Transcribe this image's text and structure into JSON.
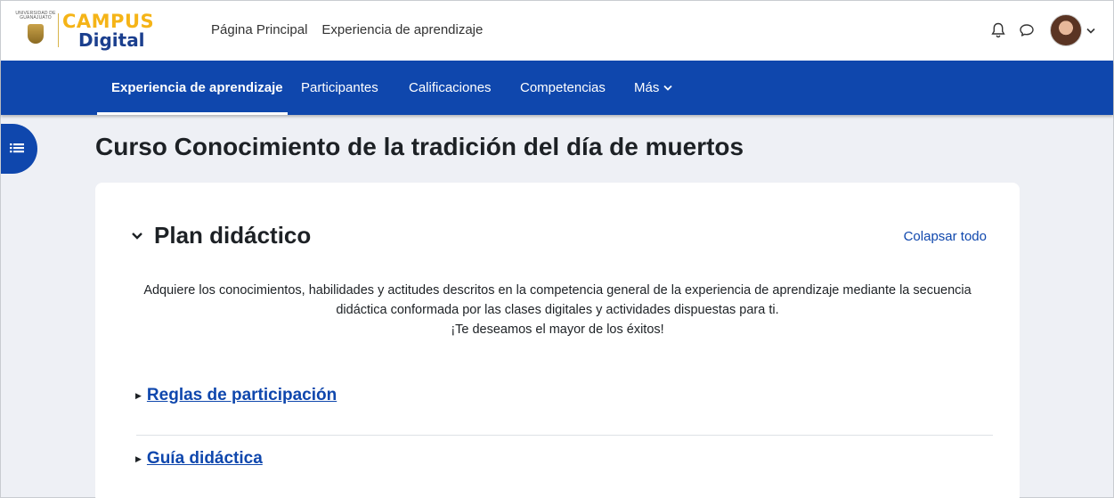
{
  "brand": {
    "university_text": "UNIVERSIDAD DE GUANAJUATO",
    "campus": "CAMPUS",
    "digital": "Digital",
    "colors": {
      "campus": "#f5b417",
      "digital": "#1b3f8e"
    }
  },
  "topnav": {
    "links": [
      "Página Principal",
      "Experiencia de aprendizaje"
    ]
  },
  "user_menu": {
    "icons": [
      "bell-icon",
      "chat-bubble-icon",
      "avatar",
      "chevron-down-icon"
    ]
  },
  "secondary_nav": {
    "items": [
      "Experiencia de aprendizaje",
      "Participantes",
      "Calificaciones",
      "Competencias",
      "Más"
    ],
    "active_index": 0,
    "color": "#0f47ad"
  },
  "drawer": {
    "icon": "course-index-icon"
  },
  "page": {
    "title": "Curso Conocimiento de la tradición del día de muertos"
  },
  "section": {
    "title": "Plan didáctico",
    "collapse_all": "Colapsar todo",
    "intro_line1": "Adquiere los conocimientos, habilidades y actitudes descritos en la competencia general de la experiencia de aprendizaje mediante la secuencia",
    "intro_line2": "didáctica conformada por las clases digitales y actividades dispuestas para ti.",
    "intro_line3": "¡Te deseamos el mayor de los éxitos!",
    "activities": [
      "Reglas de participación",
      "Guía didáctica"
    ]
  }
}
